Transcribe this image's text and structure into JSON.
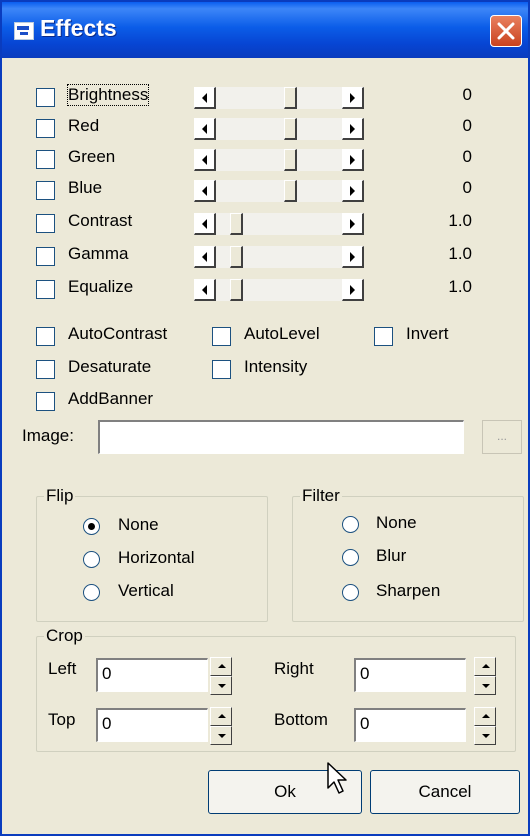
{
  "window": {
    "title": "Effects"
  },
  "sliders": [
    {
      "label": "Brightness",
      "value": "0",
      "checked": false,
      "level": 0.5
    },
    {
      "label": "Red",
      "value": "0",
      "checked": false,
      "level": 0.5
    },
    {
      "label": "Green",
      "value": "0",
      "checked": false,
      "level": 0.5
    },
    {
      "label": "Blue",
      "value": "0",
      "checked": false,
      "level": 0.5
    },
    {
      "label": "Contrast",
      "value": "1.0",
      "checked": false,
      "level": 0.1
    },
    {
      "label": "Gamma",
      "value": "1.0",
      "checked": false,
      "level": 0.1
    },
    {
      "label": "Equalize",
      "value": "1.0",
      "checked": false,
      "level": 0.1
    }
  ],
  "options": {
    "autocontrast": "AutoContrast",
    "autolevel": "AutoLevel",
    "invert": "Invert",
    "desaturate": "Desaturate",
    "intensity": "Intensity",
    "addbanner": "AddBanner"
  },
  "image": {
    "label": "Image:",
    "value": "",
    "browse_label": "..."
  },
  "flip": {
    "title": "Flip",
    "options": [
      "None",
      "Horizontal",
      "Vertical"
    ],
    "selected": "None"
  },
  "filter": {
    "title": "Filter",
    "options": [
      "None",
      "Blur",
      "Sharpen"
    ],
    "selected": ""
  },
  "crop": {
    "title": "Crop",
    "left_label": "Left",
    "left_value": "0",
    "right_label": "Right",
    "right_value": "0",
    "top_label": "Top",
    "top_value": "0",
    "bottom_label": "Bottom",
    "bottom_value": "0"
  },
  "buttons": {
    "ok": "Ok",
    "cancel": "Cancel"
  },
  "icons": {
    "app": "effects-window-icon",
    "close": "close-icon",
    "cursor": "mouse-pointer-icon"
  }
}
